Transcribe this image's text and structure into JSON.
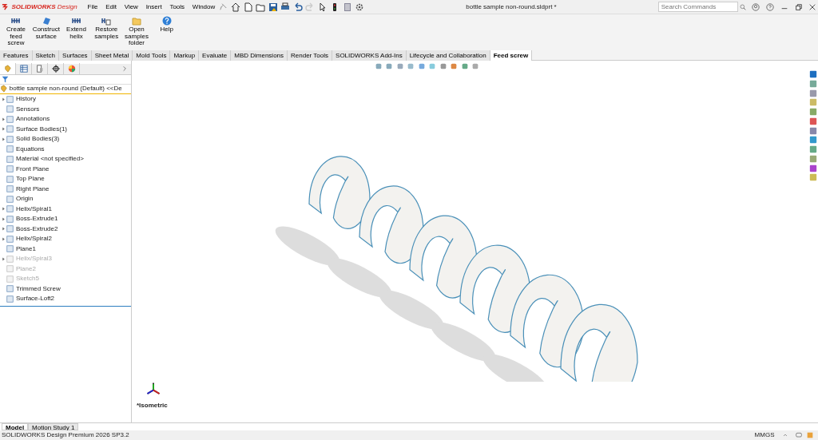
{
  "app": {
    "logo": "SOLIDWORKS",
    "edition": "Design"
  },
  "menu": [
    "File",
    "Edit",
    "View",
    "Insert",
    "Tools",
    "Window"
  ],
  "document_title": "bottle sample non-round.sldprt *",
  "search": {
    "placeholder": "Search Commands"
  },
  "ribbon": [
    {
      "label": "Create feed screw",
      "kind": "tool"
    },
    {
      "label": "Construct surface",
      "kind": "surface"
    },
    {
      "label": "Extend helix",
      "kind": "tool"
    },
    {
      "label": "Restore samples",
      "kind": "restore"
    },
    {
      "label": "Open samples folder",
      "kind": "folder"
    },
    {
      "label": "Help",
      "kind": "help"
    }
  ],
  "tabs": [
    {
      "label": "Features",
      "selected": false
    },
    {
      "label": "Sketch",
      "selected": false
    },
    {
      "label": "Surfaces",
      "selected": false
    },
    {
      "label": "Sheet Metal",
      "selected": false
    },
    {
      "label": "Mold Tools",
      "selected": false
    },
    {
      "label": "Markup",
      "selected": false
    },
    {
      "label": "Evaluate",
      "selected": false
    },
    {
      "label": "MBD Dimensions",
      "selected": false
    },
    {
      "label": "Render Tools",
      "selected": false
    },
    {
      "label": "SOLIDWORKS Add-Ins",
      "selected": false
    },
    {
      "label": "Lifecycle and Collaboration",
      "selected": false
    },
    {
      "label": "Feed screw",
      "selected": true
    }
  ],
  "tree": {
    "root": "bottle sample non-round (Default) <<De",
    "items": [
      {
        "label": "History",
        "expandable": true,
        "suppressed": false
      },
      {
        "label": "Sensors",
        "expandable": false,
        "suppressed": false
      },
      {
        "label": "Annotations",
        "expandable": true,
        "suppressed": false
      },
      {
        "label": "Surface Bodies(1)",
        "expandable": true,
        "suppressed": false
      },
      {
        "label": "Solid Bodies(3)",
        "expandable": true,
        "suppressed": false
      },
      {
        "label": "Equations",
        "expandable": false,
        "suppressed": false
      },
      {
        "label": "Material <not specified>",
        "expandable": false,
        "suppressed": false
      },
      {
        "label": "Front Plane",
        "expandable": false,
        "suppressed": false
      },
      {
        "label": "Top Plane",
        "expandable": false,
        "suppressed": false
      },
      {
        "label": "Right Plane",
        "expandable": false,
        "suppressed": false
      },
      {
        "label": "Origin",
        "expandable": false,
        "suppressed": false
      },
      {
        "label": "Helix/Spiral1",
        "expandable": true,
        "suppressed": false
      },
      {
        "label": "Boss-Extrude1",
        "expandable": true,
        "suppressed": false
      },
      {
        "label": "Boss-Extrude2",
        "expandable": true,
        "suppressed": false
      },
      {
        "label": "Helix/Spiral2",
        "expandable": true,
        "suppressed": false
      },
      {
        "label": "Plane1",
        "expandable": false,
        "suppressed": false
      },
      {
        "label": "Helix/Spiral3",
        "expandable": true,
        "suppressed": true
      },
      {
        "label": "Plane2",
        "expandable": false,
        "suppressed": true
      },
      {
        "label": "Sketch5",
        "expandable": false,
        "suppressed": true
      },
      {
        "label": "Trimmed Screw",
        "expandable": false,
        "suppressed": false
      },
      {
        "label": "Surface-Loft2",
        "expandable": false,
        "suppressed": false
      }
    ]
  },
  "view": {
    "label": "*Isometric"
  },
  "bottom_tabs": [
    {
      "label": "Model",
      "selected": true
    },
    {
      "label": "Motion Study 1",
      "selected": false
    }
  ],
  "status_bar": {
    "text": "SOLIDWORKS Design Premium 2026 SP3.2",
    "units": "MMGS"
  }
}
